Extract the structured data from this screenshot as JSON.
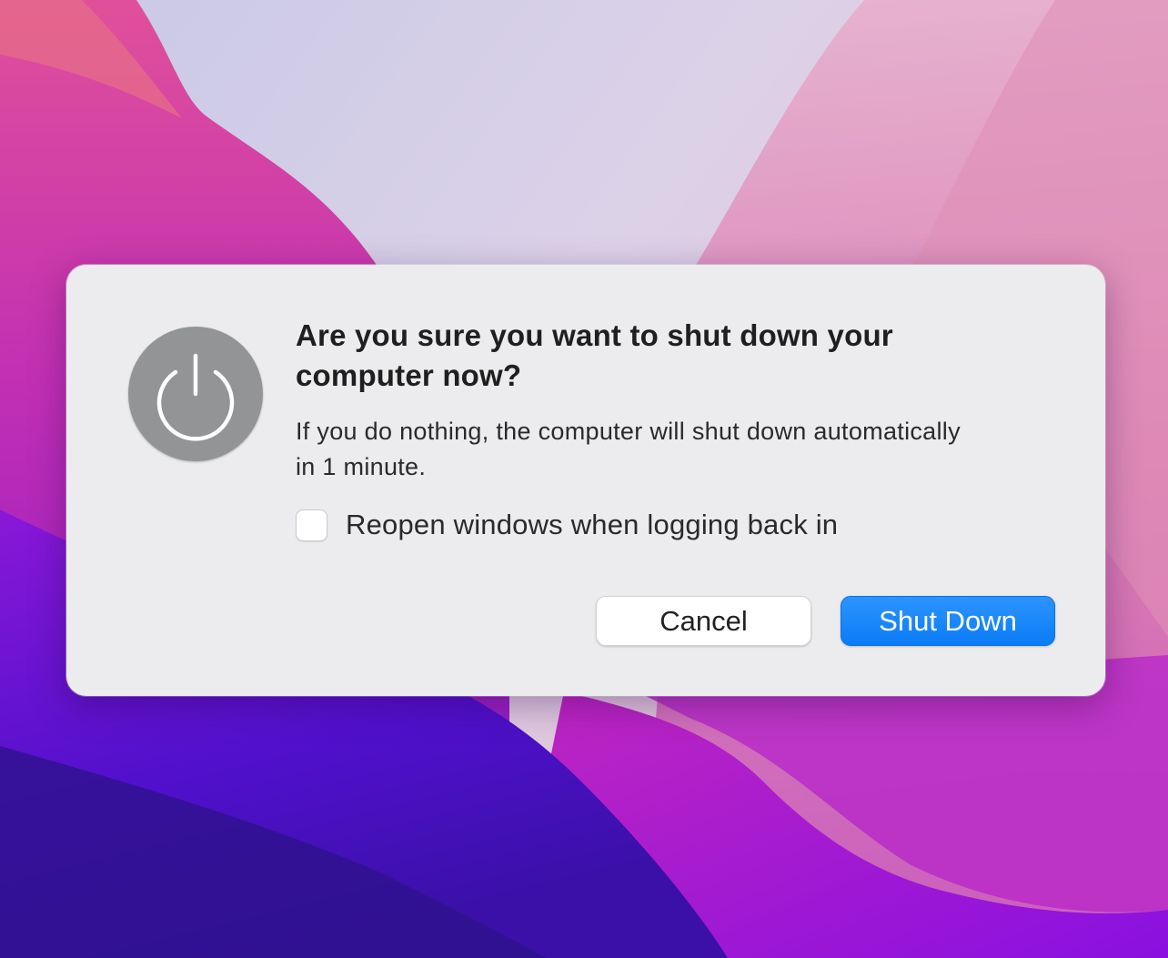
{
  "dialog": {
    "icon": "power-icon",
    "title": "Are you sure you want to shut down your computer now?",
    "message": "If you do nothing, the computer will shut down automatically in 1 minute.",
    "checkbox": {
      "label": "Reopen windows when logging back in",
      "checked": false
    },
    "buttons": {
      "cancel_label": "Cancel",
      "primary_label": "Shut Down"
    }
  },
  "colors": {
    "dialog_background": "#ececee",
    "icon_background": "#929496",
    "primary_button": "#0a7cf6",
    "wallpaper_accent_pink": "#d63aa8",
    "wallpaper_accent_purple": "#5a10d0"
  }
}
